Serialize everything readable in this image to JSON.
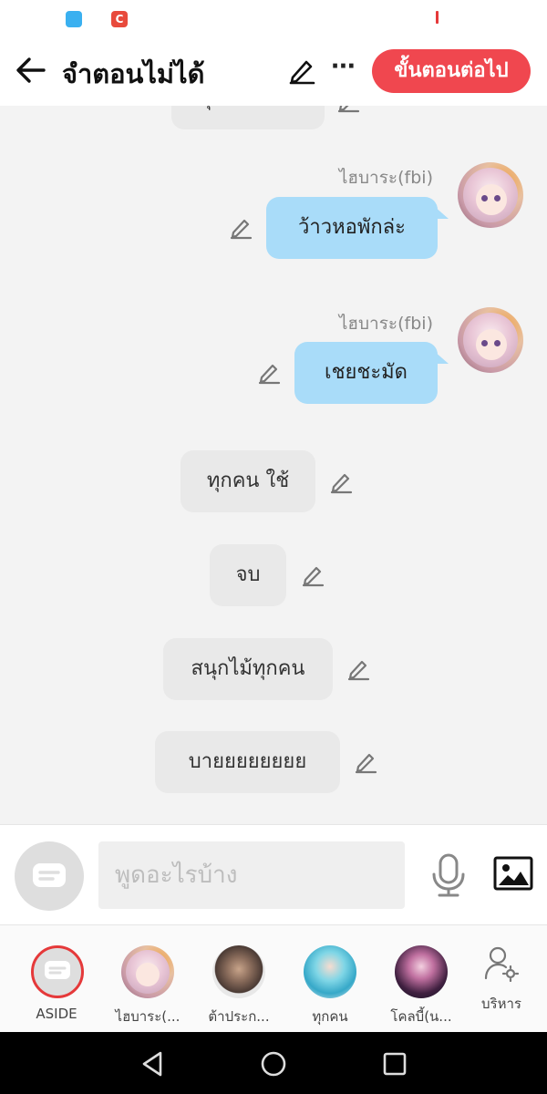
{
  "header": {
    "title": "จำตอนไม่ได้",
    "next_button": "ขั้นตอนต่อไป",
    "more_glyph": "···"
  },
  "messages": [
    {
      "type": "narration",
      "text": "ทุกคน นั่นแ"
    },
    {
      "type": "character",
      "sender": "ไฮบาระ(fbi)",
      "text": "ว้าวหอพักล่ะ"
    },
    {
      "type": "character",
      "sender": "ไฮบาระ(fbi)",
      "text": "เชยชะมัด"
    },
    {
      "type": "narration",
      "text": "ทุกคน ใช้"
    },
    {
      "type": "narration",
      "text": "จบ"
    },
    {
      "type": "narration",
      "text": "สนุกไม้ทุกคน"
    },
    {
      "type": "narration",
      "text": "บายยยยยยยย"
    }
  ],
  "input": {
    "placeholder": "พูดอะไรบ้าง"
  },
  "tabs": [
    {
      "label": "ASIDE"
    },
    {
      "label": "ไฮบาระ(..."
    },
    {
      "label": "ต้าประก..."
    },
    {
      "label": "ทุกคน"
    },
    {
      "label": "โคลบี้(น..."
    },
    {
      "label": "บริหาร"
    }
  ],
  "colors": {
    "accent": "#f0474f",
    "bubble_blue": "#a9dcf9",
    "bubble_gray": "#e9e9e9",
    "chat_bg": "#f3f3f3"
  }
}
